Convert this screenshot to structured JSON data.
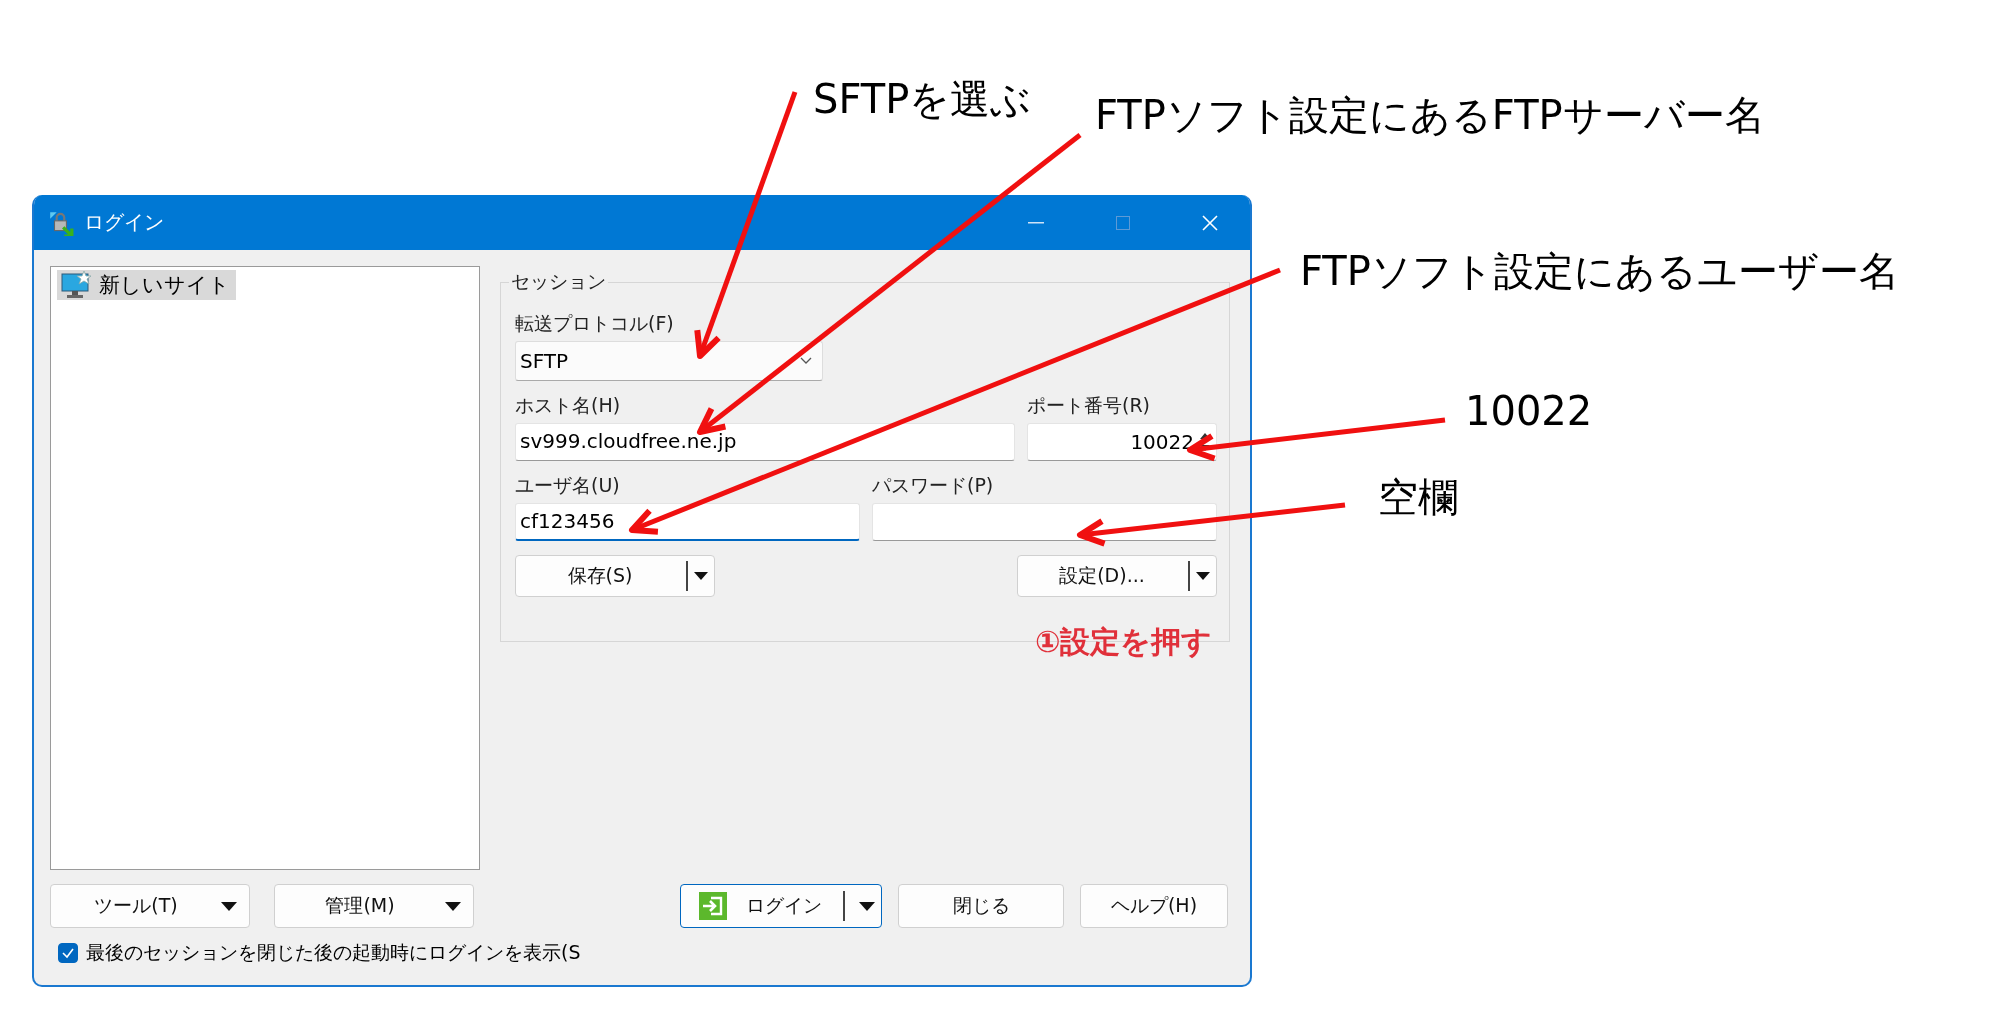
{
  "annotations": [
    {
      "text": "SFTPを選ぶ",
      "kind": "callout"
    },
    {
      "text": "FTPソフト設定にあるFTPサーバー名",
      "kind": "callout"
    },
    {
      "text": "FTPソフト設定にあるユーザー名",
      "kind": "callout"
    },
    {
      "text": "10022",
      "kind": "callout"
    },
    {
      "text": "空欄",
      "kind": "callout"
    },
    {
      "text": "①設定を押す",
      "kind": "note"
    }
  ],
  "window": {
    "title": "ログイン"
  },
  "sites": [
    {
      "label": "新しいサイト",
      "selected": true
    }
  ],
  "session": {
    "legend": "セッション",
    "protocol": {
      "label": "転送プロトコル(F)",
      "value": "SFTP"
    },
    "host": {
      "label": "ホスト名(H)",
      "value": "sv999.cloudfree.ne.jp"
    },
    "port": {
      "label": "ポート番号(R)",
      "value": "10022"
    },
    "user": {
      "label": "ユーザ名(U)",
      "value": "cf123456",
      "focused": true
    },
    "password": {
      "label": "パスワード(P)",
      "focused": false
    },
    "save_button": "保存(S)",
    "advanced_button": "設定(D)..."
  },
  "left_buttons": [
    "ツール(T)",
    "管理(M)"
  ],
  "buttons": [
    {
      "label": "ログイン",
      "kind": "primary"
    },
    {
      "label": "閉じる",
      "kind": "plain"
    },
    {
      "label": "ヘルプ(H)",
      "kind": "plain"
    }
  ],
  "checkbox": {
    "label": "最後のセッションを閉じた後の起動時にログインを表示(S",
    "checked": true
  }
}
